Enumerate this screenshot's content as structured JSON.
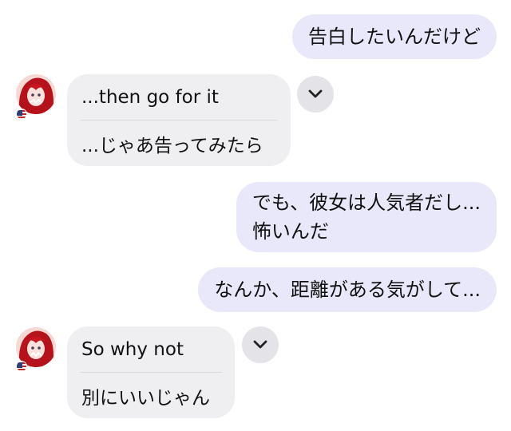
{
  "messages": [
    {
      "side": "out",
      "text": "告白したいんだけど"
    },
    {
      "side": "in",
      "original": "...then go for it",
      "translation": "...じゃあ告ってみたら"
    },
    {
      "side": "out",
      "lines": [
        "でも、彼女は人気者だし...",
        "怖いんだ"
      ]
    },
    {
      "side": "out",
      "text": "なんか、距離がある気がして..."
    },
    {
      "side": "in",
      "original": "So why not",
      "translation": "別にいいじゃん"
    }
  ],
  "icons": {
    "avatar": "anime-avatar-red-hair",
    "flag": "us-flag-icon",
    "expand": "chevron-down-icon"
  },
  "colors": {
    "outgoing_bubble": "#e9e8fb",
    "incoming_bubble": "#efeff2",
    "chevron_button": "#e4e4e8"
  }
}
